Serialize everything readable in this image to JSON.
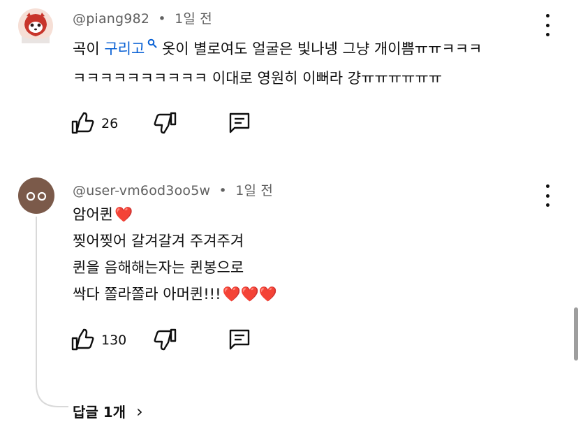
{
  "comments": [
    {
      "author": "@piang982",
      "separator": "•",
      "time": "1일 전",
      "avatar_icon": "red-panda-avatar-icon",
      "lines": [
        {
          "before": "곡이 ",
          "link": "구리고",
          "link_icon": "search-icon",
          "after": " 옷이 별로여도 얼굴은 빛나넹 그냥 개이쁨ㅠㅠㅋㅋㅋ"
        },
        {
          "text": "ㅋㅋㅋㅋㅋㅋㅋㅋㅋㅋ 이대로 영원히 이뻐라 걍ㅠㅠㅠㅠㅠㅠ"
        }
      ],
      "likes": "26"
    },
    {
      "author": "@user-vm6od3oo5w",
      "separator": "•",
      "time": "1일 전",
      "avatar_icon": "brown-face-avatar-icon",
      "lines": [
        {
          "text": "암어퀸",
          "hearts": "❤️"
        },
        {
          "text": "찢어찢어 갈겨갈겨 주겨주겨"
        },
        {
          "text": "퀸을 음해해는자는 퀸봉으로"
        },
        {
          "text": "싹다 쫄라쫄라 아머퀸!!!",
          "hearts": "❤️❤️❤️"
        }
      ],
      "likes": "130",
      "replies_label": "답글 1개",
      "replies_chevron": "›"
    }
  ],
  "colors": {
    "text": "#0f0f0f",
    "meta": "#606060",
    "link": "#065fd4",
    "heart": "#e0102a",
    "thread_line": "#d9d9d9",
    "scrollbar": "#9e9e9e"
  }
}
